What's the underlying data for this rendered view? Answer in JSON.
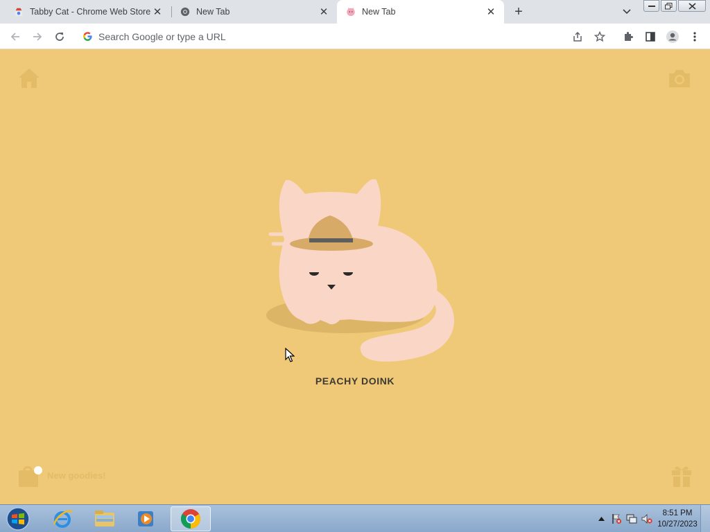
{
  "tabs": [
    {
      "title": "Tabby Cat - Chrome Web Store",
      "favicon": "webstore-icon"
    },
    {
      "title": "New Tab",
      "favicon": "chrome-icon"
    },
    {
      "title": "New Tab",
      "favicon": "tabby-cat-icon",
      "active": true
    }
  ],
  "omnibox": {
    "placeholder": "Search Google or type a URL"
  },
  "page": {
    "cat_name": "PEACHY DOINK",
    "goodies_label": "New goodies!",
    "background_color": "#efc977",
    "cat_color": "#fad6c7"
  },
  "clock": {
    "time": "8:51 PM",
    "date": "10/27/2023"
  }
}
